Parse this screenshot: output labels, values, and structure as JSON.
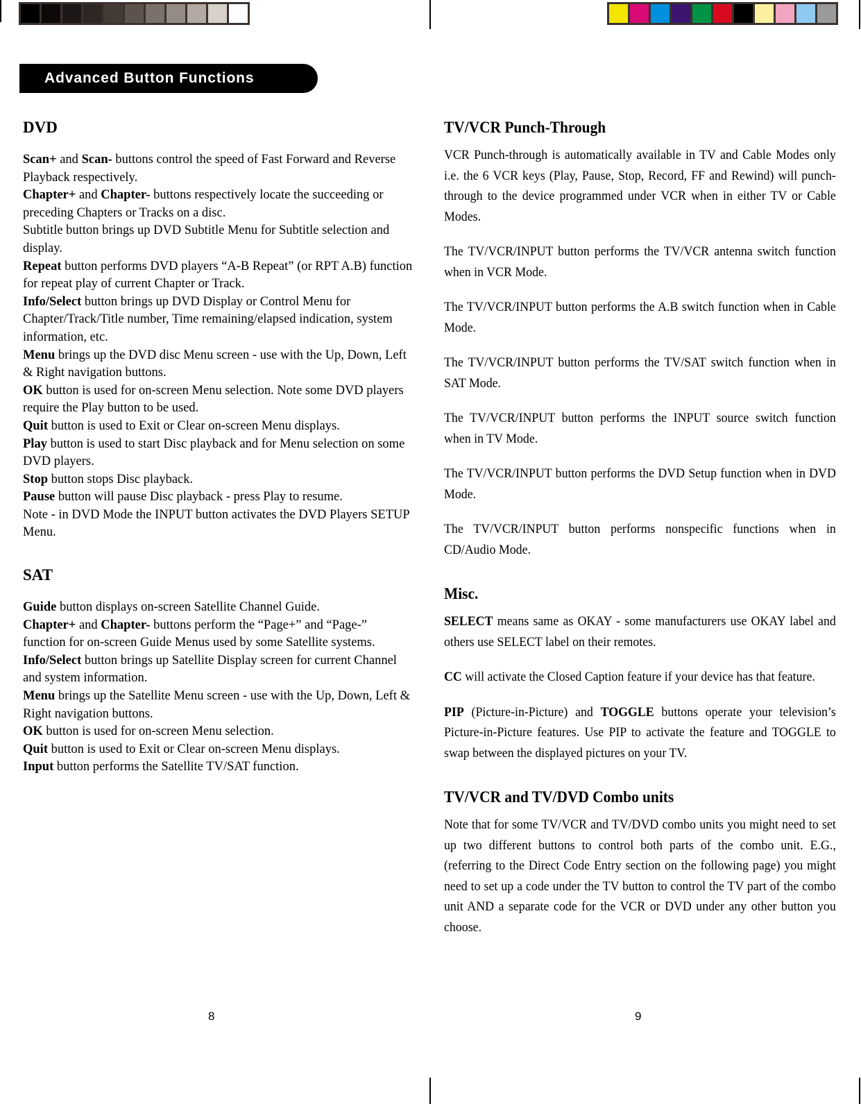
{
  "document": {
    "banner_title": "Advanced Button Functions",
    "page_number_left": "8",
    "page_number_right": "9"
  },
  "calibration": {
    "grayscale_label": "grayscale-calibration-bar",
    "grayscale_swatches": [
      "#000000",
      "#0d0909",
      "#1d1817",
      "#2e2623",
      "#443b35",
      "#5d534c",
      "#7b716a",
      "#958b84",
      "#b3a9a2",
      "#d7d1ca",
      "#ffffff"
    ],
    "color_label": "color-calibration-bar",
    "color_swatches": [
      "#f4e500",
      "#d80a73",
      "#0090dd",
      "#3b1470",
      "#009344",
      "#d80a20",
      "#000000",
      "#faf0a0",
      "#f2a5c0",
      "#8fc9f0",
      "#9a9a9a"
    ]
  },
  "left_column": {
    "sections": [
      {
        "heading": "DVD",
        "paragraphs": [
          [
            {
              "b": "Scan+"
            },
            {
              "t": " and "
            },
            {
              "b": "Scan-"
            },
            {
              "t": " buttons control the speed of Fast Forward and Reverse Playback respectively."
            }
          ],
          [
            {
              "b": "Chapter+"
            },
            {
              "t": " and "
            },
            {
              "b": "Chapter-"
            },
            {
              "t": " buttons respectively locate the succeeding or preceding Chapters or Tracks on a disc."
            }
          ],
          [
            {
              "t": "Subtitle button brings up DVD Subtitle Menu for Subtitle selection and display."
            }
          ],
          [
            {
              "b": "Repeat"
            },
            {
              "t": " button performs DVD players “A-B Repeat” (or RPT A.B) function for repeat play of current Chapter or Track."
            }
          ],
          [
            {
              "b": "Info/Select"
            },
            {
              "t": " button brings up DVD Display or Control Menu for Chapter/Track/Title number, Time remaining/elapsed indication, system information, etc."
            }
          ],
          [
            {
              "b": "Menu"
            },
            {
              "t": " brings up the DVD disc Menu screen - use with the Up, Down, Left & Right navigation buttons."
            }
          ],
          [
            {
              "b": "OK"
            },
            {
              "t": " button is used for on-screen Menu selection. Note some DVD players require the Play button to be used."
            }
          ],
          [
            {
              "b": "Quit"
            },
            {
              "t": " button is used to Exit or Clear on-screen Menu displays."
            }
          ],
          [
            {
              "b": "Play"
            },
            {
              "t": " button is used to start Disc playback and for Menu selection on some DVD players."
            }
          ],
          [
            {
              "b": "Stop"
            },
            {
              "t": " button stops Disc playback."
            }
          ],
          [
            {
              "b": "Pause"
            },
            {
              "t": " button will pause Disc playback - press Play to resume."
            }
          ],
          [
            {
              "t": "Note - in DVD Mode the INPUT button activates the DVD Players SETUP Menu."
            }
          ]
        ]
      },
      {
        "heading": "SAT",
        "paragraphs": [
          [
            {
              "b": "Guide"
            },
            {
              "t": " button displays on-screen Satellite Channel Guide."
            }
          ],
          [
            {
              "b": "Chapter+"
            },
            {
              "t": " and "
            },
            {
              "b": "Chapter-"
            },
            {
              "t": " buttons perform the “Page+” and “Page-” function for on-screen Guide Menus used by some Satellite systems."
            }
          ],
          [
            {
              "b": "Info/Select"
            },
            {
              "t": " button brings up Satellite Display screen for current Channel and system information."
            }
          ],
          [
            {
              "b": "Menu"
            },
            {
              "t": " brings up the Satellite Menu screen - use with the Up, Down, Left & Right navigation buttons."
            }
          ],
          [
            {
              "b": "OK"
            },
            {
              "t": " button is used for on-screen Menu selection."
            }
          ],
          [
            {
              "b": "Quit"
            },
            {
              "t": " button is used to Exit or Clear on-screen Menu displays."
            }
          ],
          [
            {
              "b": "Input"
            },
            {
              "t": " button performs the Satellite TV/SAT function."
            }
          ]
        ]
      }
    ]
  },
  "right_column": {
    "sections": [
      {
        "heading": "TV/VCR Punch-Through",
        "paragraphs": [
          [
            {
              "t": "VCR Punch-through is automatically available in TV and Cable Modes only i.e. the 6 VCR keys (Play, Pause, Stop, Record, FF and Rewind) will punch-through to the device programmed under VCR when in either TV or Cable Modes."
            }
          ],
          [
            {
              "t": "The TV/VCR/INPUT button performs the TV/VCR antenna switch function when in VCR Mode."
            }
          ],
          [
            {
              "t": "The TV/VCR/INPUT button performs the A.B switch function when in Cable Mode."
            }
          ],
          [
            {
              "t": "The TV/VCR/INPUT button performs the TV/SAT switch function when in SAT Mode."
            }
          ],
          [
            {
              "t": "The TV/VCR/INPUT button performs the INPUT source switch function when in TV Mode."
            }
          ],
          [
            {
              "t": "The TV/VCR/INPUT button performs the DVD Setup function when in DVD Mode."
            }
          ],
          [
            {
              "t": "The TV/VCR/INPUT button performs nonspecific functions when in CD/Audio Mode."
            }
          ]
        ]
      },
      {
        "heading": "Misc.",
        "paragraphs": [
          [
            {
              "b": "SELECT"
            },
            {
              "t": " means same as OKAY - some manufacturers use OKAY label and others use SELECT label on their remotes."
            }
          ],
          [
            {
              "b": "CC"
            },
            {
              "t": " will activate the Closed Caption feature if your device has that feature."
            }
          ],
          [
            {
              "b": "PIP"
            },
            {
              "t": " (Picture-in-Picture) and "
            },
            {
              "b": "TOGGLE"
            },
            {
              "t": " buttons operate your television’s Picture-in-Picture features. Use PIP to activate the feature and TOGGLE to swap between the displayed pictures on your TV."
            }
          ]
        ]
      },
      {
        "heading": "TV/VCR and TV/DVD Combo units",
        "paragraphs": [
          [
            {
              "t": "Note that for some TV/VCR and TV/DVD combo units you might need to set up two different buttons to control both parts of the combo unit. E.G., (referring to the  Direct Code Entry section on the following page) you might need to set up a code under the TV button to control the TV part of the combo unit AND a separate code for the VCR or DVD under any other button you choose."
            }
          ]
        ]
      }
    ]
  }
}
